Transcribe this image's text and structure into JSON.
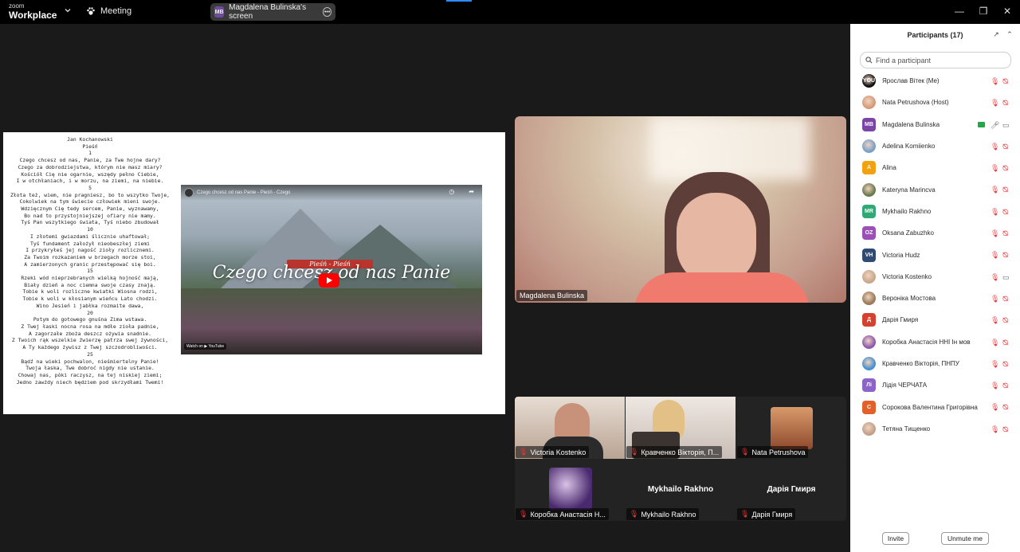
{
  "app": {
    "brand_small": "zoom",
    "brand": "Workplace",
    "meeting_label": "Meeting"
  },
  "share_pill": {
    "initials": "MB",
    "label": "Magdalena Bulinska's screen"
  },
  "document": {
    "author": "Jan Kochanowski",
    "genre": "Pieśń",
    "poem_lines": [
      "Jan Kochanowski",
      "Pieśń",
      "1",
      "Czego chcesz od nas, Panie, za Twe hojne dary?",
      "Czego za dobrodziejstwa, którym nie masz miary?",
      "Kościół Cię nie ogarnie, wszędy pełno Ciebie,",
      "I w otchłaniach, i w morzu, na ziemi, na niebie.",
      "5",
      "Złota też, wiem, nie pragniesz, bo to wszytko Twoje,",
      "Cokolwiek na tym świecie człowiek mieni swoje.",
      "Wdzięcznym Cię tedy sercem, Panie, wyznawamy,",
      "Bo nad to przystojniejszej ofiary nie mamy.",
      "Tyś Pan wszytkiego świata, Tyś niebo zbudował",
      "10",
      "I złotemi gwiazdami ślicznie uhaftował;",
      "Tyś fundament założył nieobeszłej ziemi",
      "I przykryłeś jej nagość zioły rozlicznemi.",
      "Za Twoim rozkazaniem w brzegach morze stoi,",
      "A zamierzonych granic przestępować się boi.",
      "15",
      "Rzeki wód nieprzebranych wielką hojność mają,",
      "Biały dzień a noc ciemna swoje czasy znają.",
      "Tobie k woli rozliczne kwiatki Wiosna rodzi,",
      "Tobie k woli w kłosianym wieńcu Lato chodzi.",
      "Wino Jesień i jabłka rozmaite dawa,",
      "20",
      "Potym do gotowego gnuśna Zima wstawa.",
      "Z Twej łaski nocna rosa na mdłe zioła padnie,",
      "A zagorzałe zboża deszcz ożywia snadnie.",
      "Z Twoich rąk wszelkie źwierzę patrza swej żywności,",
      "A Ty każdego żywisz z Twej szczodrobliwości.",
      "25",
      "Bądź na wieki pochwalon, nieśmiertelny Panie!",
      "Twoja łaska, Twe dobroć nigdy nie ustanie.",
      "Chowaj nas, póki raczysz, na tej niskiej ziemi;",
      "Jedno zawżdy niech będziem pod skrzydłami Twemi!"
    ],
    "video": {
      "bar_title": "Czego chcesz od nas Panie - Pieśń - Czego",
      "share_label": "Share",
      "tag": "Pieśń - Pieśń",
      "title": "Czego chcesz od nas Panie",
      "watch_label": "Watch on ▶ YouTube"
    }
  },
  "active_speaker": {
    "name": "Magdalena Bulinska"
  },
  "gallery": [
    {
      "name": "Victoria Kostenko",
      "muted": true
    },
    {
      "name": "Кравченко Вікторія, П...",
      "muted": true
    },
    {
      "name": "Nata Petrushova",
      "muted": true
    },
    {
      "name": "Коробка Анастасія Н...",
      "muted": true
    },
    {
      "name": "Mykhailo Rakhno",
      "big": "Mykhailo Rakhno",
      "muted": true
    },
    {
      "name": "Дарія Гмиря",
      "big": "Дарія Гмиря",
      "muted": true
    }
  ],
  "panel": {
    "title": "Participants (17)",
    "search_placeholder": "Find a participant",
    "invite": "Invite",
    "unmute_me": "Unmute me",
    "participants": [
      {
        "initials": "YOU",
        "name": "Ярослав Вітек (Me)",
        "color": "#111111",
        "photo": true
      },
      {
        "initials": "",
        "name": "Nata Petrushova (Host)",
        "color": "#d59a7a",
        "photo": true
      },
      {
        "initials": "MB",
        "name": "Magdalena Bulinska",
        "color": "#7b45a8",
        "sharing": true,
        "mic_on": true,
        "video_on": true
      },
      {
        "initials": "",
        "name": "Adelina Komiienko",
        "color": "#7aa0c8",
        "photo": true
      },
      {
        "initials": "A",
        "name": "Alina",
        "color": "#f2a111"
      },
      {
        "initials": "",
        "name": "Kateryna Marincva",
        "color": "#6c7a4f",
        "photo": true
      },
      {
        "initials": "MR",
        "name": "Mykhailo Rakhno",
        "color": "#32a877"
      },
      {
        "initials": "OZ",
        "name": "Oksana Zabuzhko",
        "color": "#9d4fb8"
      },
      {
        "initials": "VH",
        "name": "Victoria Hudz",
        "color": "#2f4b73"
      },
      {
        "initials": "",
        "name": "Victoria Kostenko",
        "color": "#c9a88c",
        "photo": true,
        "video_on": true
      },
      {
        "initials": "",
        "name": "Вероніка Мостова",
        "color": "#9a7a5a",
        "photo": true
      },
      {
        "initials": "Д",
        "name": "Дарія Гмиря",
        "color": "#d4412e"
      },
      {
        "initials": "",
        "name": "Коробка Анастасія ННІ Ін мов",
        "color": "#8c5ab0",
        "photo": true
      },
      {
        "initials": "",
        "name": "Кравченко Вікторія, ПНПУ",
        "color": "#4a8fd0",
        "photo": true
      },
      {
        "initials": "Лі",
        "name": "Лідія ЧЕРЧАТА",
        "color": "#8b63c9"
      },
      {
        "initials": "С",
        "name": "Сорокова Валентина Григорівна",
        "color": "#e0622a"
      },
      {
        "initials": "",
        "name": "Тетяна Тищенко",
        "color": "#c4a08a",
        "photo": true
      }
    ]
  },
  "colors": {
    "accent": "#2d8cff",
    "muted_red": "#e5383b",
    "share_green": "#22a946"
  }
}
